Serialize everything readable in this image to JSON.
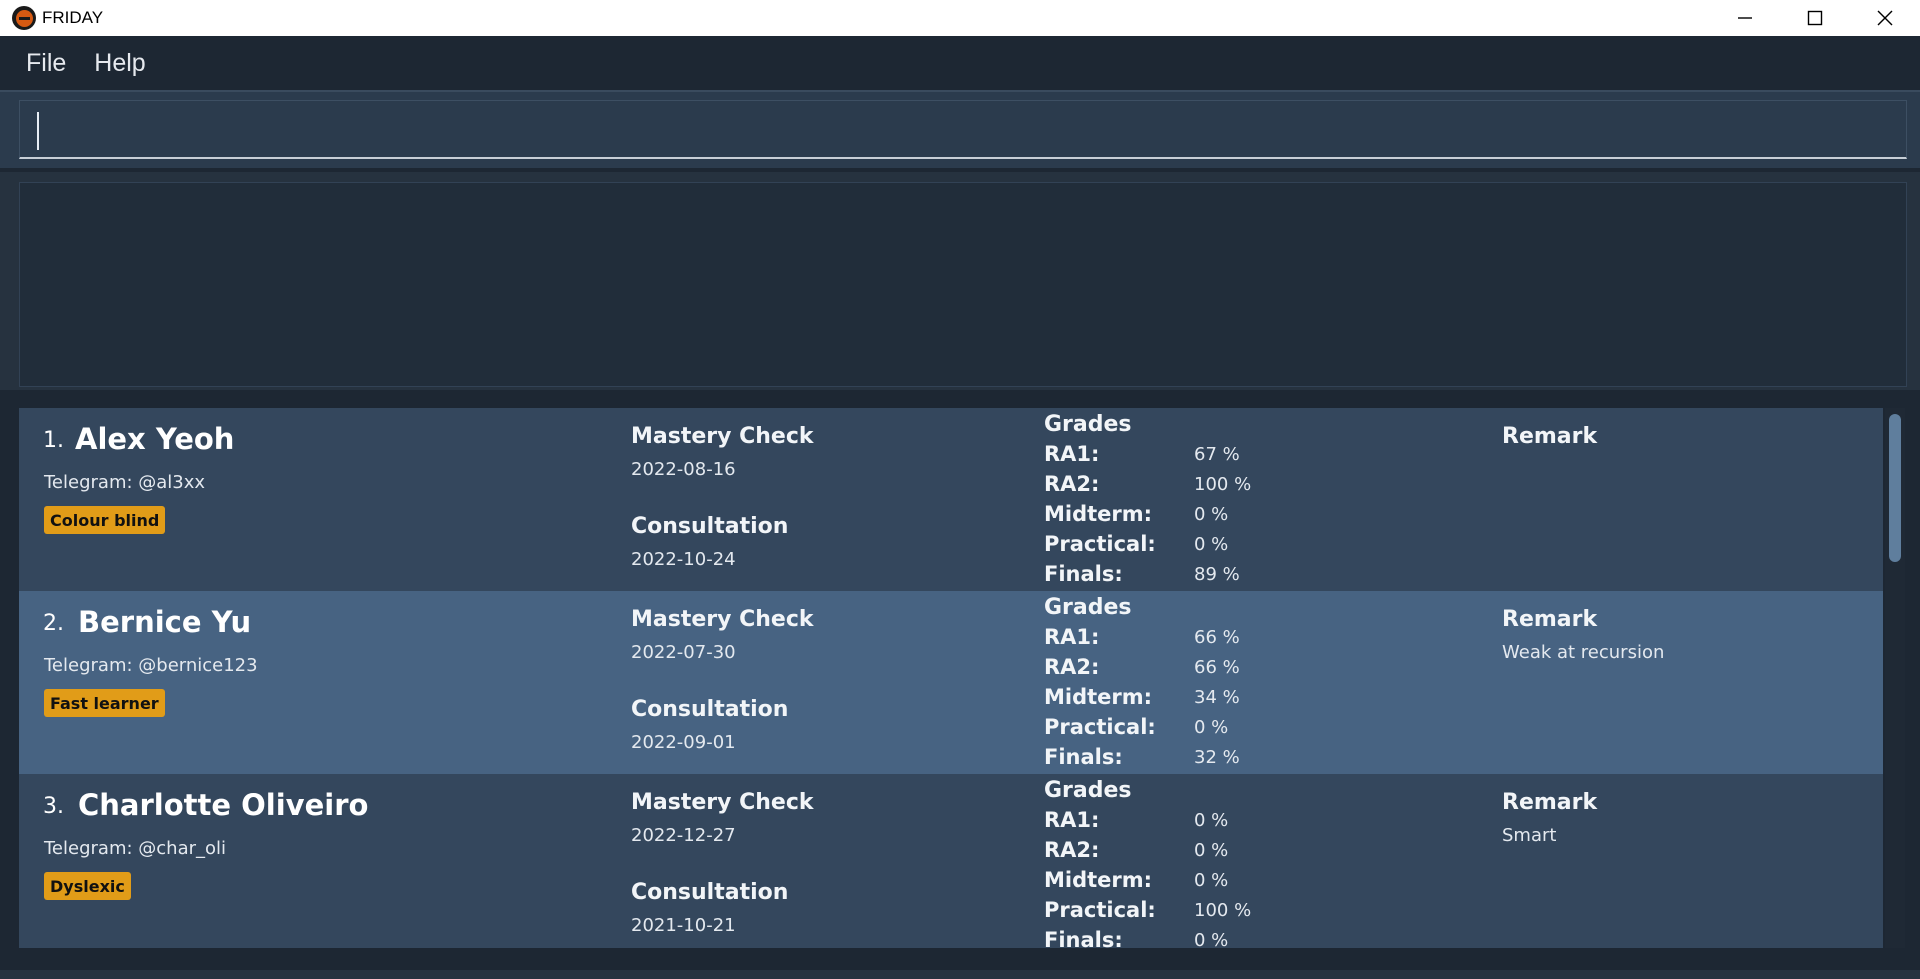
{
  "window": {
    "title": "FRIDAY"
  },
  "menu": {
    "file": "File",
    "help": "Help"
  },
  "command": {
    "value": "",
    "placeholder": ""
  },
  "result": {
    "text": ""
  },
  "labels": {
    "mastery": "Mastery Check",
    "consultation": "Consultation",
    "grades": "Grades",
    "remark": "Remark",
    "ra1": "RA1:",
    "ra2": "RA2:",
    "midterm": "Midterm:",
    "practical": "Practical:",
    "finals": "Finals:"
  },
  "students": [
    {
      "index": "1.",
      "name": "Alex Yeoh",
      "telegram": "Telegram: @al3xx",
      "tag": "Colour blind",
      "mastery_date": "2022-08-16",
      "consultation_date": "2022-10-24",
      "ra1": "67 %",
      "ra2": "100 %",
      "midterm": "0 %",
      "practical": "0 %",
      "finals": "89 %",
      "remark": ""
    },
    {
      "index": "2.",
      "name": "Bernice Yu",
      "telegram": "Telegram: @bernice123",
      "tag": "Fast learner",
      "mastery_date": "2022-07-30",
      "consultation_date": "2022-09-01",
      "ra1": "66 %",
      "ra2": "66 %",
      "midterm": "34 %",
      "practical": "0 %",
      "finals": "32 %",
      "remark": "Weak at recursion"
    },
    {
      "index": "3.",
      "name": "Charlotte Oliveiro",
      "telegram": "Telegram: @char_oli",
      "tag": "Dyslexic",
      "mastery_date": "2022-12-27",
      "consultation_date": "2021-10-21",
      "ra1": "0 %",
      "ra2": "0 %",
      "midterm": "0 %",
      "practical": "100 %",
      "finals": "0 %",
      "remark": "Smart"
    }
  ],
  "colors": {
    "card_odd": "#34475d",
    "card_even": "#476382",
    "tag": "#e19c18",
    "background": "#1d2733"
  }
}
